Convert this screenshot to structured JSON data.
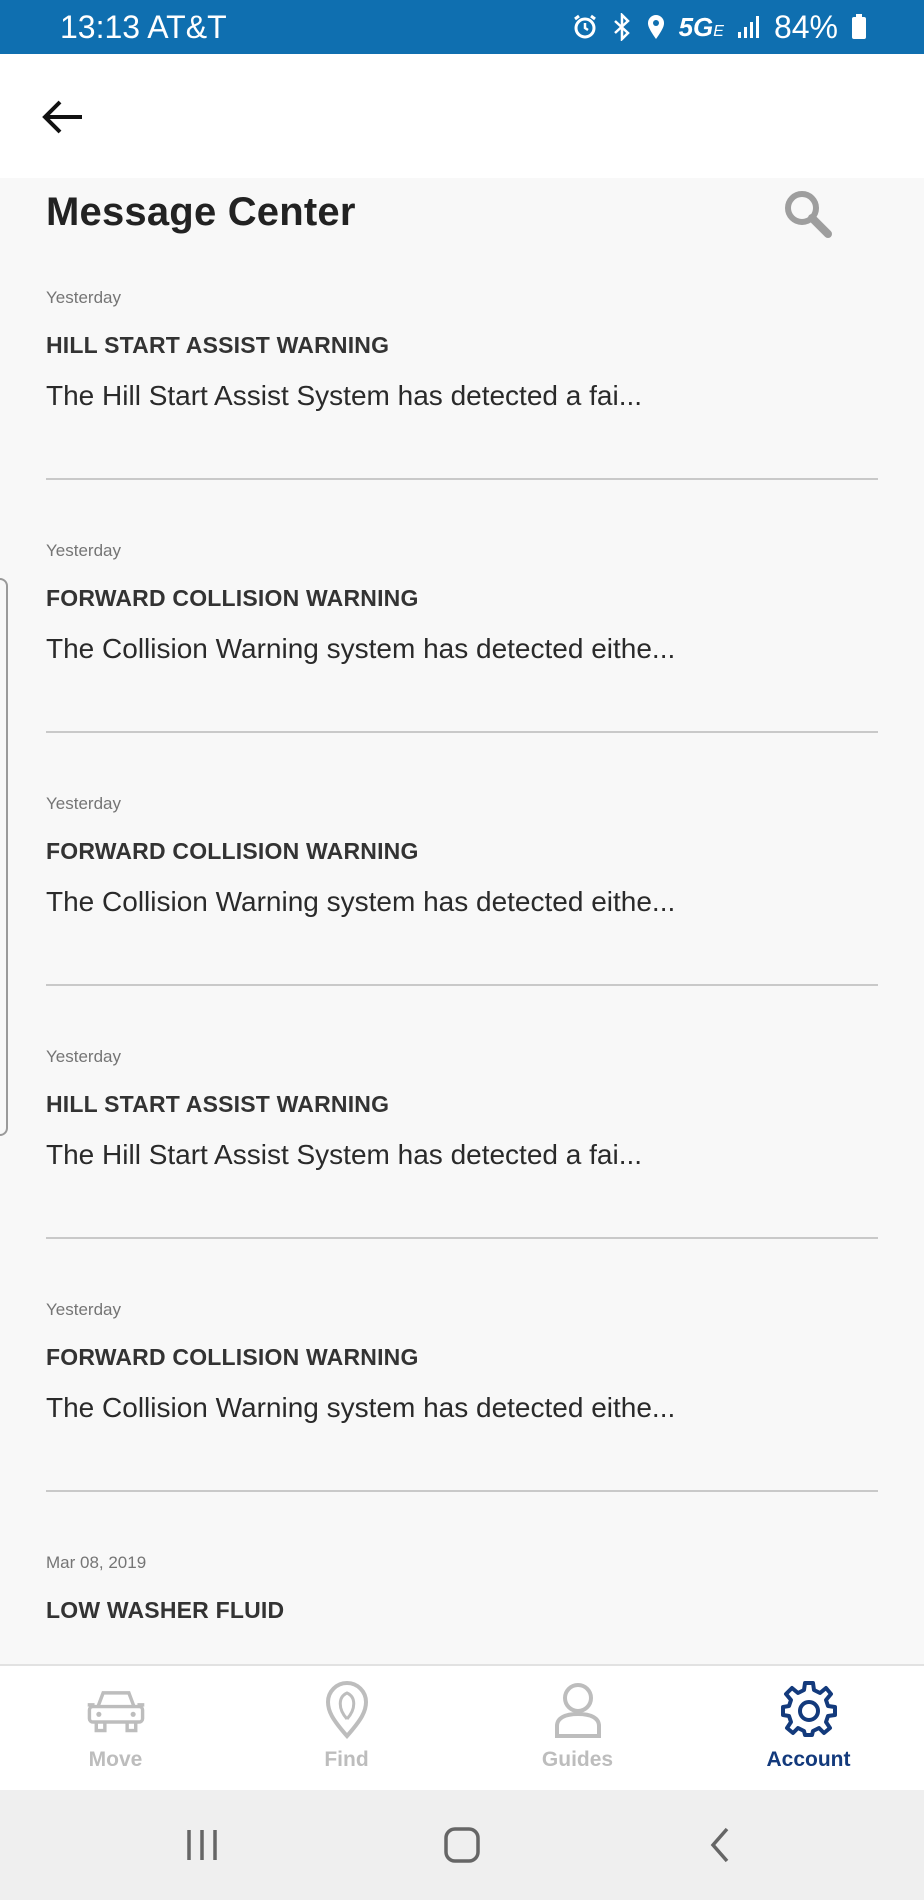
{
  "status_bar": {
    "time": "13:13 AT&T",
    "network": "5G",
    "network_sub": "E",
    "battery": "84%"
  },
  "header": {
    "title": "Message Center"
  },
  "messages": [
    {
      "date": "Yesterday",
      "title": "HILL START ASSIST WARNING",
      "preview": "The Hill Start Assist System has detected a fai..."
    },
    {
      "date": "Yesterday",
      "title": "FORWARD COLLISION WARNING",
      "preview": "The Collision Warning system has detected eithe..."
    },
    {
      "date": "Yesterday",
      "title": "FORWARD COLLISION WARNING",
      "preview": "The Collision Warning system has detected eithe..."
    },
    {
      "date": "Yesterday",
      "title": "HILL START ASSIST WARNING",
      "preview": "The Hill Start Assist System has detected a fai..."
    },
    {
      "date": "Yesterday",
      "title": "FORWARD COLLISION WARNING",
      "preview": "The Collision Warning system has detected eithe..."
    },
    {
      "date": "Mar 08, 2019",
      "title": "LOW WASHER FLUID",
      "preview": ""
    }
  ],
  "bottom_nav": {
    "items": [
      {
        "label": "Move",
        "icon": "car-icon",
        "active": false
      },
      {
        "label": "Find",
        "icon": "location-pin-icon",
        "active": false
      },
      {
        "label": "Guides",
        "icon": "person-icon",
        "active": false
      },
      {
        "label": "Account",
        "icon": "gear-icon",
        "active": true
      }
    ]
  },
  "colors": {
    "status_bar": "#0f6fb0",
    "active_nav": "#133a7c",
    "inactive_nav": "#bdbdbd"
  }
}
